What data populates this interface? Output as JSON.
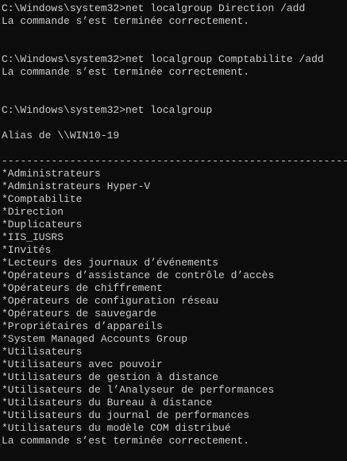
{
  "terminal": {
    "colors": {
      "background": "#0c0c0c",
      "foreground": "#cccccc"
    },
    "blocks": [
      {
        "prompt": "C:\\Windows\\system32>",
        "command": "net localgroup Direction /add",
        "output": "La commande s’est terminée correctement."
      },
      {
        "prompt": "C:\\Windows\\system32>",
        "command": "net localgroup Comptabilite /add",
        "output": "La commande s’est terminée correctement."
      },
      {
        "prompt": "C:\\Windows\\system32>",
        "command": "net localgroup"
      }
    ],
    "alias_header": "Alias de \\\\WIN10-19",
    "separator": "-------------------------------------------------------------------------------",
    "groups": [
      "*Administrateurs",
      "*Administrateurs Hyper-V",
      "*Comptabilite",
      "*Direction",
      "*Duplicateurs",
      "*IIS_IUSRS",
      "*Invités",
      "*Lecteurs des journaux d’événements",
      "*Opérateurs d’assistance de contrôle d’accès",
      "*Opérateurs de chiffrement",
      "*Opérateurs de configuration réseau",
      "*Opérateurs de sauvegarde",
      "*Propriétaires d’appareils",
      "*System Managed Accounts Group",
      "*Utilisateurs",
      "*Utilisateurs avec pouvoir",
      "*Utilisateurs de gestion à distance",
      "*Utilisateurs de l’Analyseur de performances",
      "*Utilisateurs du Bureau à distance",
      "*Utilisateurs du journal de performances",
      "*Utilisateurs du modèle COM distribué"
    ],
    "final_output": "La commande s’est terminée correctement."
  }
}
